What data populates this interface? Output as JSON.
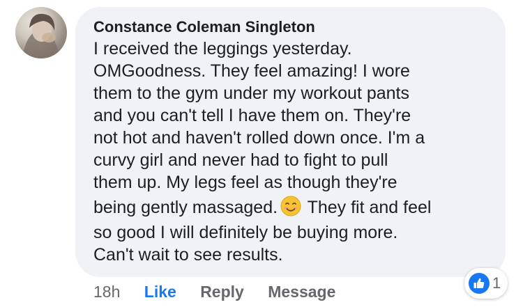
{
  "comment": {
    "author": "Constance Coleman Singleton",
    "lines": [
      "I received the leggings yesterday.",
      "OMGoodness. They feel amazing! I wore",
      "them to the gym under my workout pants",
      "and you can't tell I have them on. They're",
      "not hot and haven't rolled down once. I'm a",
      "curvy girl and never had to fight to pull",
      "them up. My legs feel as though they're"
    ],
    "emoji_line_before": "being gently massaged.",
    "emoji_line_after": "They fit and feel",
    "lines_after": [
      "so good I will definitely be buying more.",
      "Can't wait to see results."
    ],
    "emoji_icon": "smiling-face-emoji"
  },
  "actions": {
    "timestamp": "18h",
    "like_label": "Like",
    "reply_label": "Reply",
    "message_label": "Message"
  },
  "reactions": {
    "icon": "thumbs-up-icon",
    "count": "1"
  },
  "colors": {
    "bubble_bg": "#f0f2f5",
    "link_blue": "#1877f2",
    "secondary_text": "#65676b",
    "primary_text": "#1c1e21"
  }
}
